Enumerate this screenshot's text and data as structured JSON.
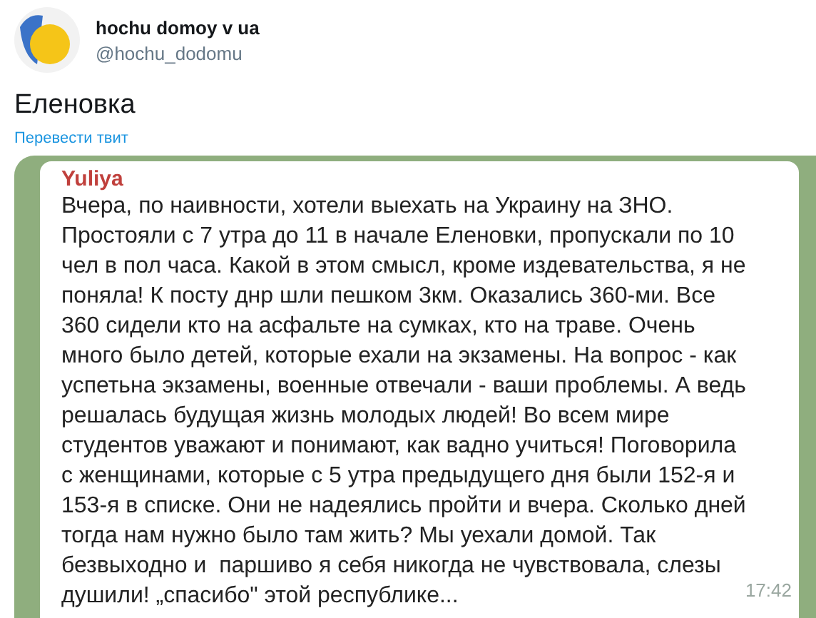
{
  "tweet": {
    "author_name": "hochu domoy v ua",
    "author_handle": "@hochu_dodomu",
    "text": "Еленовка",
    "translate_link": "Перевести твит"
  },
  "attached_screenshot": {
    "message": {
      "sender": "Yuliya",
      "lines": [
        "Вчера, по наивности, хотели выехать на Украину на ЗНО.",
        "Простояли с 7 утра до 11 в начале Еленовки, пропускали по 10",
        "чел в пол часа. Какой в этом смысл, кроме издевательства, я не",
        "поняла! К посту днр шли пешком 3км. Оказались 360-ми. Все",
        "360 сидели кто на асфальте на сумках, кто на траве. Очень",
        "много было детей, которые ехали на экзамены. На вопрос - как",
        "успетьна экзамены, военные отвечали - ваши проблемы. А ведь",
        "решалась будущая жизнь молодых людей! Во всем мире",
        "студентов уважают и понимают, как вадно учиться! Поговорила",
        "с женщинами, которые с 5 утра предыдущего дня были 152-я и",
        "153-я в списке. Они не надеялись пройти и вчера. Сколько дней",
        "тогда нам нужно было там жить? Мы уехали домой. Так",
        "безвыходно и  паршиво я себя никогда не чувствовала, слезы",
        "душили! „спасибо\" этой республике..."
      ],
      "time": "17:42"
    }
  }
}
